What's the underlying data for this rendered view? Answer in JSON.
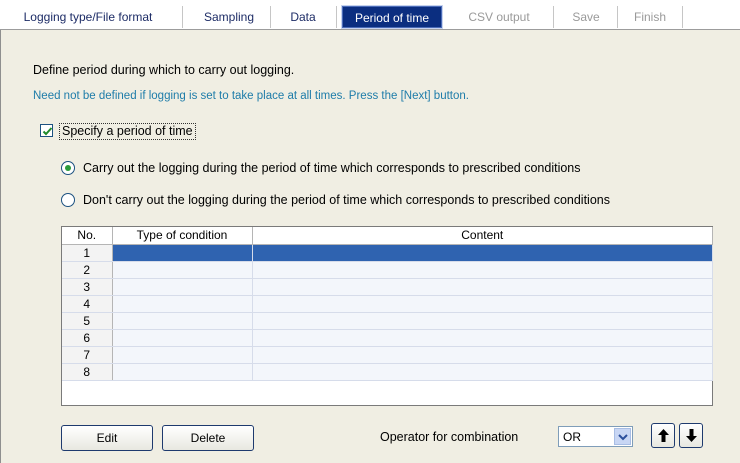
{
  "tabs": [
    {
      "label": "Logging type/File format",
      "state": "normal"
    },
    {
      "label": "Sampling",
      "state": "normal"
    },
    {
      "label": "Data",
      "state": "normal"
    },
    {
      "label": "Period of time",
      "state": "active"
    },
    {
      "label": "CSV output",
      "state": "disabled"
    },
    {
      "label": "Save",
      "state": "disabled"
    },
    {
      "label": "Finish",
      "state": "disabled"
    }
  ],
  "intro": {
    "line1": "Define period during which to carry out logging.",
    "line2": "Need not be defined if logging is set to take place at all times. Press the [Next] button."
  },
  "specify_checkbox": {
    "label": "Specify a period of time",
    "checked": true
  },
  "radios": [
    {
      "label": "Carry out the logging during the period of time which corresponds to prescribed conditions",
      "selected": true
    },
    {
      "label": "Don't carry out the logging during the period of time which corresponds to prescribed conditions",
      "selected": false
    }
  ],
  "grid": {
    "headers": [
      "No.",
      "Type of condition",
      "Content"
    ],
    "rows": [
      {
        "no": "1",
        "type": "",
        "content": ""
      },
      {
        "no": "2",
        "type": "",
        "content": ""
      },
      {
        "no": "3",
        "type": "",
        "content": ""
      },
      {
        "no": "4",
        "type": "",
        "content": ""
      },
      {
        "no": "5",
        "type": "",
        "content": ""
      },
      {
        "no": "6",
        "type": "",
        "content": ""
      },
      {
        "no": "7",
        "type": "",
        "content": ""
      },
      {
        "no": "8",
        "type": "",
        "content": ""
      }
    ],
    "selected_row": 1
  },
  "buttons": {
    "edit": "Edit",
    "delete": "Delete"
  },
  "operator": {
    "label": "Operator for combination",
    "value": "OR"
  },
  "icons": {
    "up": "arrow-up-icon",
    "down": "arrow-down-icon",
    "dropdown": "chevron-down-icon",
    "check": "checkmark-icon"
  },
  "colors": {
    "active_tab": "#0b2e80",
    "selection": "#2f63b0",
    "hint_text": "#1e7ca9",
    "radio_dot": "#2a9a3a"
  }
}
